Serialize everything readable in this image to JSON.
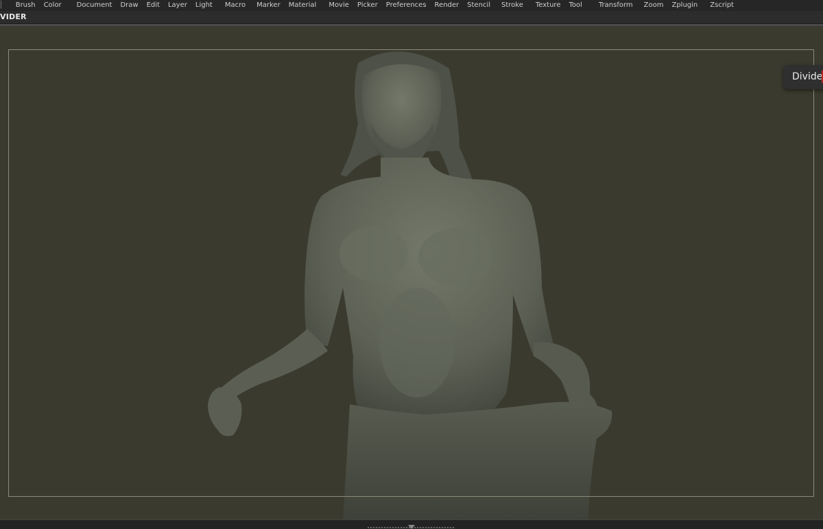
{
  "menu": {
    "items": [
      "Brush",
      "Color",
      "Document",
      "Draw",
      "Edit",
      "Layer",
      "Light",
      "Macro",
      "Marker",
      "Material",
      "Movie",
      "Picker",
      "Preferences",
      "Render",
      "Stencil",
      "Stroke",
      "Texture",
      "Tool",
      "Transform",
      "Zoom",
      "Zplugin",
      "Zscript"
    ]
  },
  "infobar": {
    "label": "VIDER"
  },
  "tooltip": {
    "text": "Divide"
  },
  "colors": {
    "canvas_bg": "#3b3a2e",
    "sculpt": "#5d6155",
    "menubar": "#262626"
  }
}
